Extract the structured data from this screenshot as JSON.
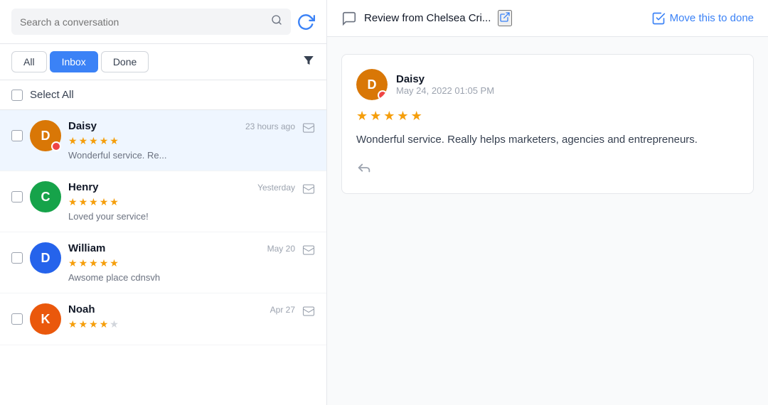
{
  "search": {
    "placeholder": "Search a conversation",
    "value": ""
  },
  "tabs": {
    "all_label": "All",
    "inbox_label": "Inbox",
    "done_label": "Done",
    "active": "Inbox"
  },
  "select_all_label": "Select All",
  "conversations": [
    {
      "id": 1,
      "name": "Daisy",
      "time": "23 hours ago",
      "stars": 5,
      "preview": "Wonderful service. Re...",
      "avatar_color": null,
      "avatar_initials": "D",
      "has_badge": true,
      "avatar_type": "image"
    },
    {
      "id": 2,
      "name": "Henry",
      "time": "Yesterday",
      "stars": 5,
      "preview": "Loved your service!",
      "avatar_color": "#16a34a",
      "avatar_initials": "C",
      "has_badge": false,
      "avatar_type": "letter"
    },
    {
      "id": 3,
      "name": "William",
      "time": "May 20",
      "stars": 5,
      "preview": "Awsome place cdnsvh",
      "avatar_color": "#2563eb",
      "avatar_initials": "D",
      "has_badge": false,
      "avatar_type": "letter"
    },
    {
      "id": 4,
      "name": "Noah",
      "time": "Apr 27",
      "stars": 4,
      "preview": "",
      "avatar_color": "#ea580c",
      "avatar_initials": "K",
      "has_badge": false,
      "avatar_type": "letter"
    }
  ],
  "right_panel": {
    "review_title": "Review from Chelsea Cri...",
    "move_done_label": "Move this to done",
    "message": {
      "sender_name": "Daisy",
      "date": "May 24, 2022 01:05 PM",
      "stars": 5,
      "text": "Wonderful service. Really helps marketers, agencies and entrepreneurs."
    }
  },
  "icons": {
    "search": "🔍",
    "refresh": "↻",
    "filter": "▼",
    "external_link": "↗",
    "review": "💬",
    "move_done": "✉",
    "reply": "↩",
    "check_icon": "✓"
  }
}
